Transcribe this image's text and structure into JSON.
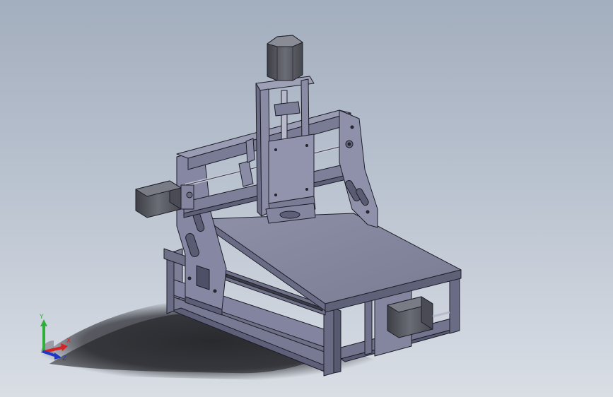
{
  "viewport": {
    "background_top": "#a3aebe",
    "background_bottom": "#d9dee5"
  },
  "model": {
    "part_color": "#7c7e96",
    "part_light": "#9698ad",
    "part_dark": "#5a5c72",
    "edge_color": "#1d1e28",
    "motor_color": "#55575f",
    "shadow_color": "#2a2a30"
  },
  "triad": {
    "x_label": "X",
    "y_label": "Y",
    "z_label": "Z",
    "x_color": "#d42424",
    "y_color": "#2fae3a",
    "z_color": "#2036c8"
  }
}
